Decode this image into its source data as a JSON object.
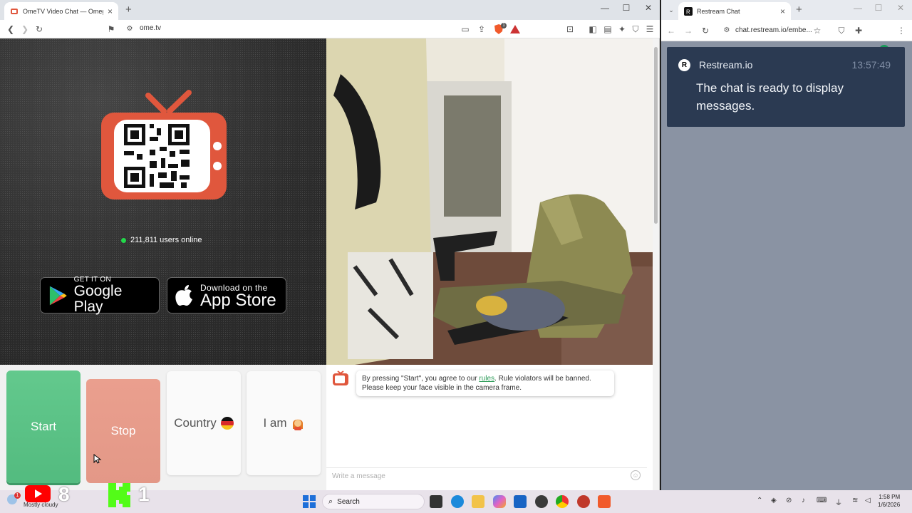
{
  "left_window": {
    "tab_title": "OmeTV Video Chat — Omeg",
    "address": "ome.tv",
    "shield_badge": "1"
  },
  "ome": {
    "online_count": "211,811 users online",
    "google_play": {
      "small": "GET IT ON",
      "big": "Google Play"
    },
    "app_store": {
      "small": "Download on the",
      "big": "App Store"
    },
    "buttons": {
      "start": "Start",
      "stop": "Stop",
      "country": "Country",
      "iam": "I am"
    },
    "notice": {
      "before": "By pressing \"Start\", you agree to our ",
      "link": "rules",
      "after": ". Rule violators will be banned.",
      "line2": "Please keep your face visible in the camera frame."
    },
    "message_placeholder": "Write a message"
  },
  "right_window": {
    "tab_title": "Restream Chat",
    "address": "chat.restream.io/embe...",
    "chat": {
      "sender": "Restream.io",
      "time": "13:57:49",
      "message": "The chat is ready to display messages."
    }
  },
  "taskbar": {
    "weather_badge": "1",
    "weather": "Mostly cloudy",
    "overlay_left_num": "8",
    "overlay_right_num": "1",
    "search": "Search",
    "time": "1:58 PM",
    "date": "1/6/2026"
  },
  "colors": {
    "start_green": "#5cc687",
    "stop_red": "#e59a8a",
    "tv_orange": "#e0573d",
    "restream_card": "#2b3a52"
  }
}
